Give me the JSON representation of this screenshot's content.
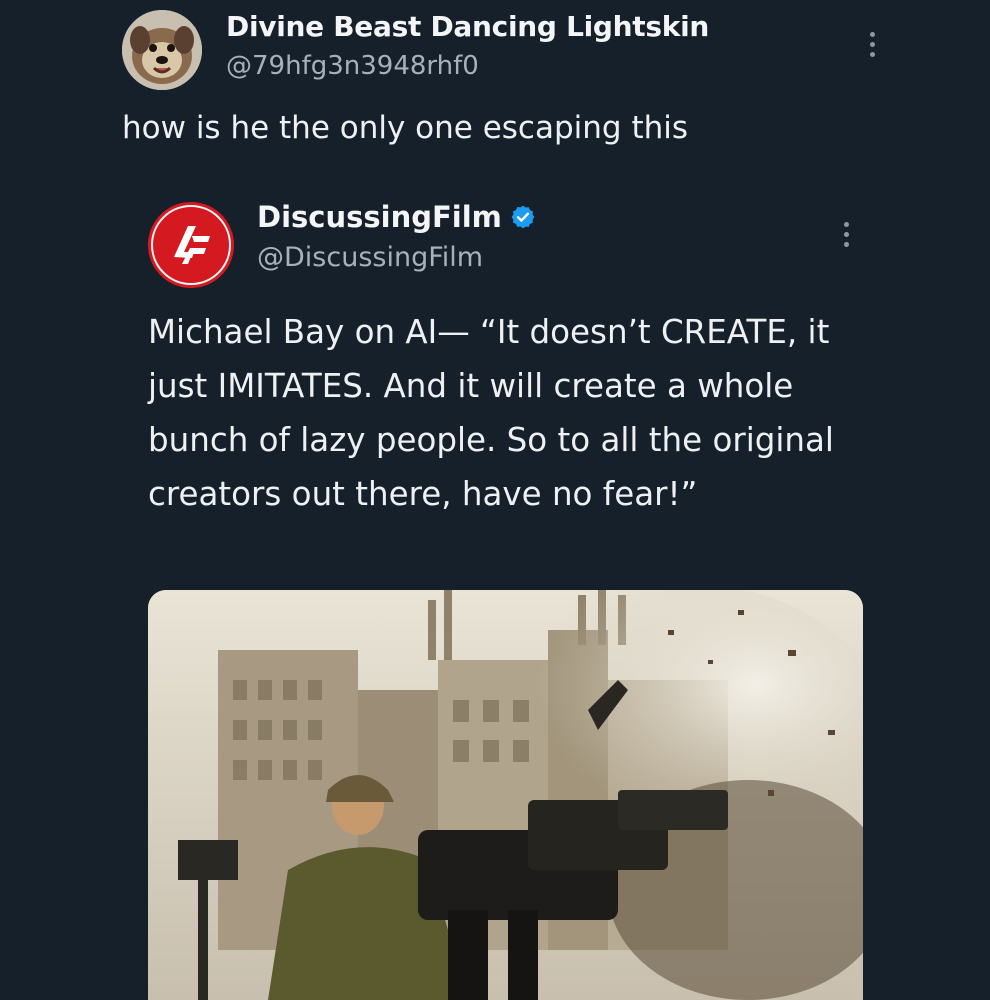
{
  "outer_tweet": {
    "display_name": "Divine Beast Dancing Lightskin",
    "handle": "@79hfg3n3948rhf0",
    "text": "how is he the only one escaping this"
  },
  "quoted_tweet": {
    "display_name": "DiscussingFilm",
    "handle": "@DiscussingFilm",
    "verified": true,
    "text": "Michael Bay on AI— “It doesn’t CREATE, it just IMITATES. And it will create a whole bunch of lazy people. So to all the original creators out there, have no fear!”"
  },
  "icons": {
    "outer_more": "more-vertical-icon",
    "quote_more": "more-vertical-icon",
    "verified": "verified-badge-icon"
  },
  "colors": {
    "background": "#15202b",
    "text_primary": "#e7e9ea",
    "text_secondary": "#a7b1bb",
    "verified_blue": "#1d9bf0",
    "brand_red": "#d41a20"
  }
}
